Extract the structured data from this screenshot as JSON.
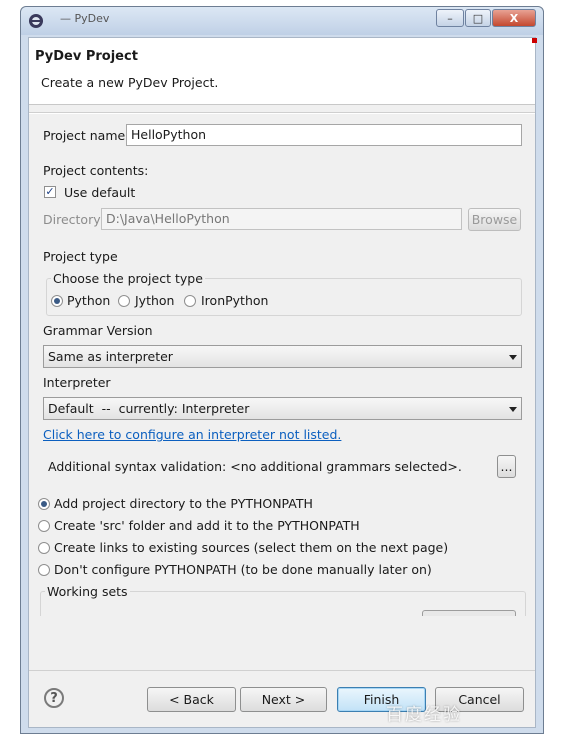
{
  "window": {
    "title": "— PyDev",
    "minimize": "–",
    "maximize": "□",
    "close": "X"
  },
  "header": {
    "title": "PyDev Project",
    "description": "Create a new PyDev Project."
  },
  "project_name": {
    "label": "Project name:",
    "value": "HelloPython"
  },
  "contents": {
    "label": "Project contents:",
    "use_default_label": "Use default",
    "use_default_checked": true,
    "directory_label": "Directory",
    "directory_value": "D:\\Java\\HelloPython",
    "browse_label": "Browse"
  },
  "project_type": {
    "label": "Project type",
    "group_label": "Choose the project type",
    "options": [
      "Python",
      "Jython",
      "IronPython"
    ],
    "selected": "Python"
  },
  "grammar": {
    "label": "Grammar Version",
    "value": "Same as interpreter"
  },
  "interpreter": {
    "label": "Interpreter",
    "value": "Default  --  currently: Interpreter",
    "configure_link": "Click here to configure an interpreter not listed."
  },
  "syntax": {
    "label": "Additional syntax validation: <no additional grammars selected>.",
    "button_label": "..."
  },
  "pythonpath": {
    "options": [
      "Add project directory to the PYTHONPATH",
      "Create 'src' folder and add it to the PYTHONPATH",
      "Create links to existing sources (select them on the next page)",
      "Don't configure PYTHONPATH (to be done manually later on)"
    ],
    "selected_index": 0
  },
  "working_sets": {
    "label": "Working sets"
  },
  "footer": {
    "help": "?",
    "back": "< Back",
    "next": "Next >",
    "finish": "Finish",
    "cancel": "Cancel"
  },
  "watermark": "百度经验"
}
